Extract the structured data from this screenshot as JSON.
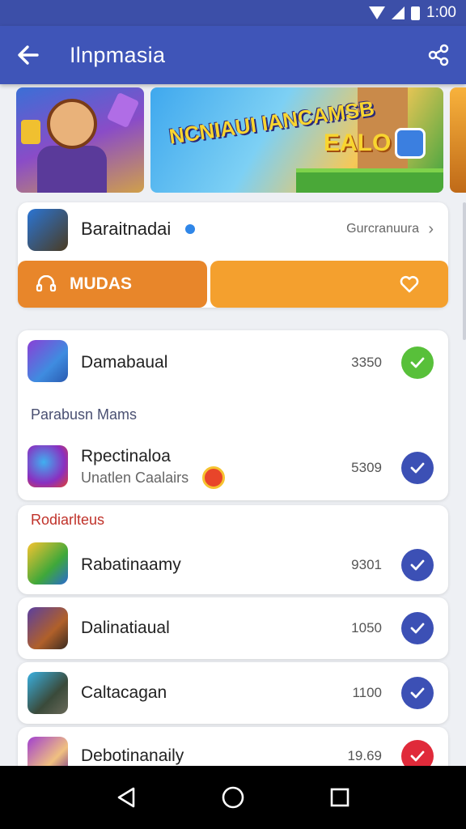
{
  "status_bar": {
    "time": "1:00"
  },
  "app_bar": {
    "title": "Ilnpmasia"
  },
  "featured": {
    "name": "Baraitnadai",
    "link_label": "Gurcranuura",
    "primary_button_label": "MUDAS"
  },
  "list_one": {
    "rows": [
      {
        "name": "Damabaual",
        "count": "3350",
        "status": "green"
      }
    ],
    "section_label": "Parabusn Mams",
    "section_rows": [
      {
        "name": "Rpectinaloa",
        "subtitle": "Unatlen Caalairs",
        "count": "5309",
        "status": "blue"
      }
    ]
  },
  "list_two": {
    "section_label": "Rodiarlteus",
    "rows": [
      {
        "name": "Rabatinaamy",
        "count": "9301",
        "status": "blue"
      },
      {
        "name": "Dalinatiaual",
        "count": "1050",
        "status": "blue"
      },
      {
        "name": "Caltacagan",
        "count": "1100",
        "status": "blue"
      },
      {
        "name": "Debotinanaily",
        "count": "19.69",
        "status": "red"
      }
    ]
  },
  "banners": {
    "banner_2_logo": "NCNIAUI IANCAMSB",
    "banner_2_brand": "EALO"
  },
  "colors": {
    "app_bar": "#3f55b8",
    "accent_orange": "#e8862a",
    "check_green": "#58c03a",
    "check_blue": "#3c50b5",
    "check_red": "#e02a3a"
  }
}
